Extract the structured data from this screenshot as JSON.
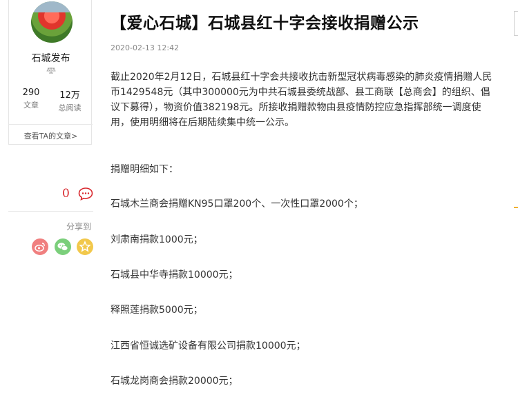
{
  "author": {
    "name": "石城发布",
    "stats": [
      {
        "value": "290",
        "label": "文章"
      },
      {
        "value": "12万",
        "label": "总阅读"
      }
    ],
    "view_all_label": "查看TA的文章>"
  },
  "interaction": {
    "comment_count": "0",
    "share_label": "分享到",
    "share_targets": [
      "weibo-icon",
      "wechat-icon",
      "favorite-icon"
    ]
  },
  "article": {
    "title": "【爱心石城】石城县红十字会接收捐赠公示",
    "timestamp": "2020-02-13 12:42",
    "intro": "截止2020年2月12日，石城县红十字会共接收抗击新型冠状病毒感染的肺炎疫情捐赠人民币1429548元（其中300000元为中共石城县委统战部、县工商联【总商会】的组织、倡议下募得），物资价值382198元。所接收捐赠款物由县疫情防控应急指挥部统一调度使用，使用明细将在后期陆续集中统一公示。",
    "lines": [
      "捐赠明细如下：",
      "石城木兰商会捐赠KN95口罩200个、一次性口罩2000个；",
      "刘肃南捐款1000元；",
      "石城县中华寺捐款10000元；",
      "释照莲捐款5000元；",
      "江西省恒诚选矿设备有限公司捐款10000元；",
      "石城龙岗商会捐款20000元；"
    ]
  },
  "colors": {
    "comment_count": "#d8262c",
    "weibo": "#f07f7f",
    "wechat": "#7bcf7b",
    "favorite": "#f2c84b"
  }
}
